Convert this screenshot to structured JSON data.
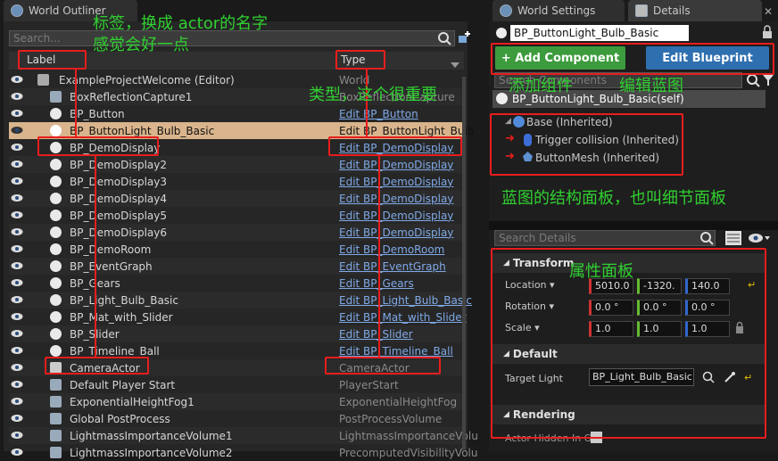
{
  "outliner": {
    "tab_title": "World Outliner",
    "search_placeholder": "Search...",
    "col_label": "Label",
    "col_type": "Type",
    "rows": [
      {
        "label": "ExampleProjectWelcome (Editor)",
        "type": "World",
        "link": false,
        "selected": false
      },
      {
        "label": "BoxReflectionCapture1",
        "type": "BoxReflectionCapture",
        "link": false,
        "selected": false
      },
      {
        "label": "BP_Button",
        "type": "Edit BP_Button",
        "link": true,
        "selected": false
      },
      {
        "label": "BP_ButtonLight_Bulb_Basic",
        "type": "Edit BP_ButtonLight_Bulb",
        "link": false,
        "selected": true
      },
      {
        "label": "BP_DemoDisplay",
        "type": "Edit BP_DemoDisplay",
        "link": true,
        "selected": false
      },
      {
        "label": "BP_DemoDisplay2",
        "type": "Edit BP_DemoDisplay",
        "link": true,
        "selected": false
      },
      {
        "label": "BP_DemoDisplay3",
        "type": "Edit BP_DemoDisplay",
        "link": true,
        "selected": false
      },
      {
        "label": "BP_DemoDisplay4",
        "type": "Edit BP_DemoDisplay",
        "link": true,
        "selected": false
      },
      {
        "label": "BP_DemoDisplay5",
        "type": "Edit BP_DemoDisplay",
        "link": true,
        "selected": false
      },
      {
        "label": "BP_DemoDisplay6",
        "type": "Edit BP_DemoDisplay",
        "link": true,
        "selected": false
      },
      {
        "label": "BP_DemoRoom",
        "type": "Edit BP_DemoRoom",
        "link": true,
        "selected": false
      },
      {
        "label": "BP_EventGraph",
        "type": "Edit BP_EventGraph",
        "link": true,
        "selected": false
      },
      {
        "label": "BP_Gears",
        "type": "Edit BP_Gears",
        "link": true,
        "selected": false
      },
      {
        "label": "BP_Light_Bulb_Basic",
        "type": "Edit BP_Light_Bulb_Basic",
        "link": true,
        "selected": false
      },
      {
        "label": "BP_Mat_with_Slider",
        "type": "Edit BP_Mat_with_Slider",
        "link": true,
        "selected": false
      },
      {
        "label": "BP_Slider",
        "type": "Edit BP_Slider",
        "link": true,
        "selected": false
      },
      {
        "label": "BP_Timeline_Ball",
        "type": "Edit BP_Timeline_Ball",
        "link": true,
        "selected": false
      },
      {
        "label": "CameraActor",
        "type": "CameraActor",
        "link": false,
        "selected": false
      },
      {
        "label": "Default Player Start",
        "type": "PlayerStart",
        "link": false,
        "selected": false
      },
      {
        "label": "ExponentialHeightFog1",
        "type": "ExponentialHeightFog",
        "link": false,
        "selected": false
      },
      {
        "label": "Global PostProcess",
        "type": "PostProcessVolume",
        "link": false,
        "selected": false
      },
      {
        "label": "LightmassImportanceVolume1",
        "type": "LightmassImportanceVolu",
        "link": false,
        "selected": false
      },
      {
        "label": "LightmassImportanceVolume2",
        "type": "PrecomputedVisibilityVolu",
        "link": false,
        "selected": false
      }
    ]
  },
  "details": {
    "tab_world_settings": "World Settings",
    "tab_details": "Details",
    "name_value": "BP_ButtonLight_Bulb_Basic",
    "add_component": "+ Add Component",
    "edit_blueprint": "Edit Blueprint",
    "search_components_placeholder": "Search Components",
    "self_item": "BP_ButtonLight_Bulb_Basic(self)",
    "tree": [
      "Base (Inherited)",
      "Trigger collision (Inherited)",
      "ButtonMesh (Inherited)"
    ],
    "search_details_placeholder": "Search Details",
    "transform_header": "Transform",
    "location_label": "Location",
    "rotation_label": "Rotation",
    "scale_label": "Scale",
    "location": [
      "5010.0",
      "-1320.",
      "140.0"
    ],
    "rotation": [
      "0.0 °",
      "0.0 °",
      "0.0 °"
    ],
    "scale": [
      "1.0",
      "1.0",
      "1.0"
    ],
    "default_header": "Default",
    "target_light_label": "Target Light",
    "target_light_value": "BP_Light_Bulb_Basic",
    "rendering_header": "Rendering",
    "actor_hidden_label": "Actor Hidden In Ga"
  },
  "annotations": {
    "label_note_1": "标签，换成 actor的名字",
    "label_note_2": "感觉会好一点",
    "type_note": "类型，这个很重要",
    "add_component_note": "添加组件",
    "edit_blueprint_note": "编辑蓝图",
    "components_note": "蓝图的结构面板，也叫细节面板",
    "properties_note": "属性面板"
  },
  "colors": {
    "annotation": "#30d030",
    "highlight_box": "#e81d1d",
    "add_component_btn": "#3c9b3c",
    "edit_blueprint_btn": "#2e6fb0",
    "link": "#7fa9e6"
  }
}
